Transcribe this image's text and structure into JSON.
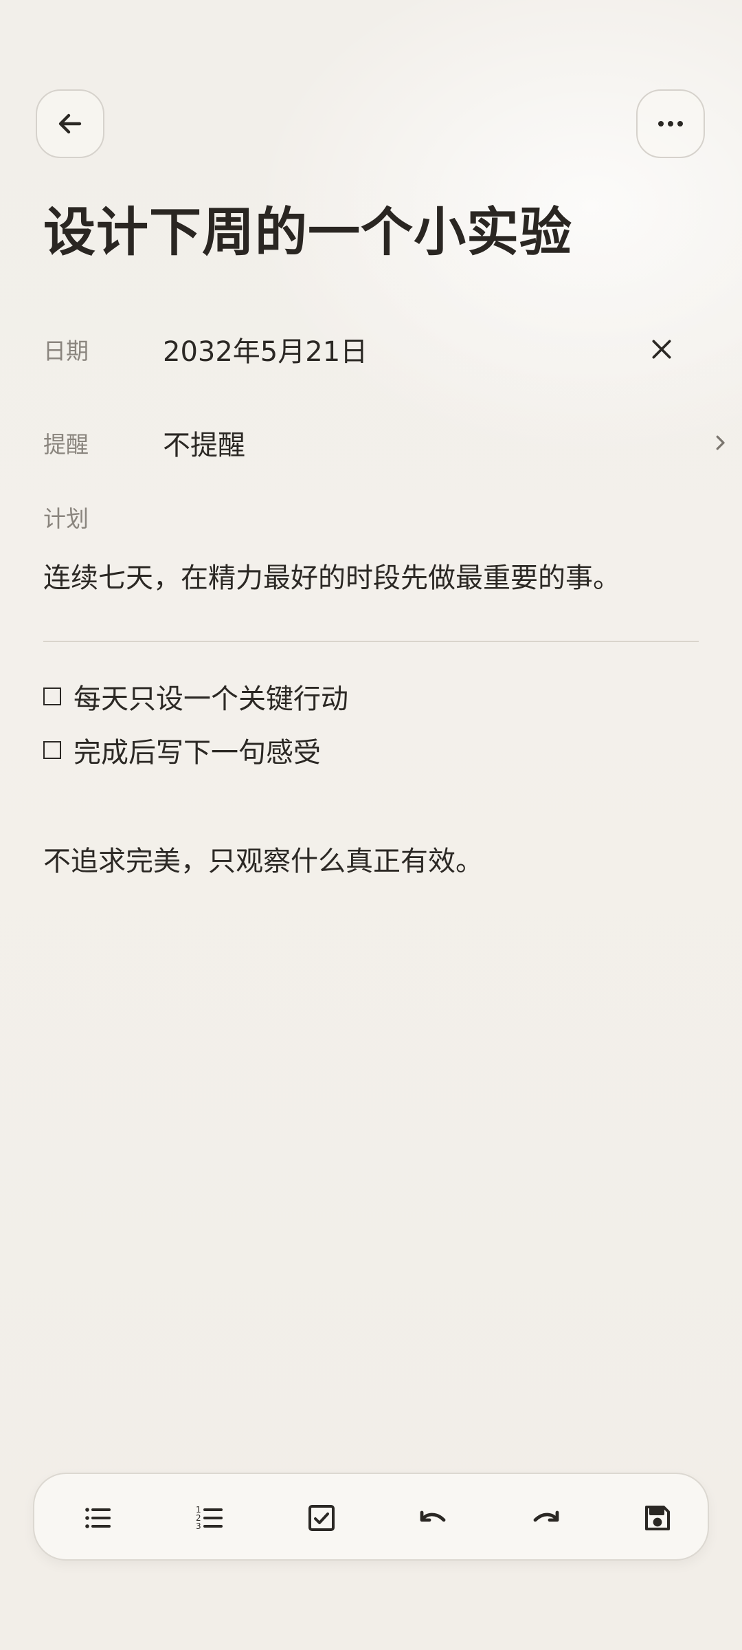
{
  "header": {
    "back_icon": "arrow-left-icon",
    "more_icon": "more-horizontal-icon"
  },
  "note": {
    "title": "设计下周的一个小实验",
    "date": {
      "label": "日期",
      "value": "2032年5月21日"
    },
    "reminder": {
      "label": "提醒",
      "value": "不提醒"
    },
    "plan": {
      "label": "计划",
      "text": "连续七天，在精力最好的时段先做最重要的事。"
    },
    "checklist": [
      {
        "text": "每天只设一个关键行动",
        "checked": false
      },
      {
        "text": "完成后写下一句感受",
        "checked": false
      }
    ],
    "footer_text": "不追求完美，只观察什么真正有效。"
  },
  "toolbar": {
    "items": [
      "bulleted-list-icon",
      "numbered-list-icon",
      "checkbox-icon",
      "undo-icon",
      "redo-icon",
      "save-icon"
    ]
  },
  "colors": {
    "background": "#f2efea",
    "text": "#2b2824",
    "muted": "#8a857e",
    "border": "#d6d2cc"
  }
}
